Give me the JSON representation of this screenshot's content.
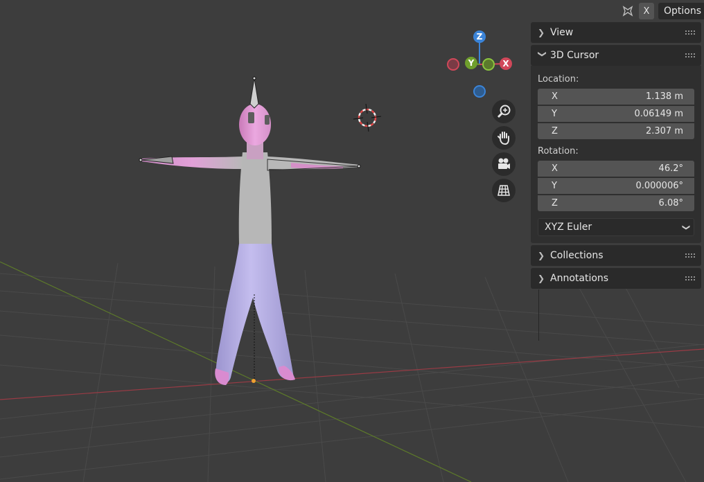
{
  "header": {
    "xray_label": "X",
    "options_label": "Options"
  },
  "nav_gizmo": {
    "z_label": "Z",
    "y_label": "Y",
    "x_label": "X"
  },
  "sidebar": {
    "view_label": "View",
    "cursor_label": "3D Cursor",
    "location_label": "Location:",
    "location": [
      {
        "axis": "X",
        "value": "1.138 m"
      },
      {
        "axis": "Y",
        "value": "0.06149 m"
      },
      {
        "axis": "Z",
        "value": "2.307 m"
      }
    ],
    "rotation_label": "Rotation:",
    "rotation": [
      {
        "axis": "X",
        "value": "46.2°"
      },
      {
        "axis": "Y",
        "value": "0.000006°"
      },
      {
        "axis": "Z",
        "value": "6.08°"
      }
    ],
    "rotation_mode": "XYZ Euler",
    "collections_label": "Collections",
    "annotations_label": "Annotations"
  },
  "icons": [
    "zoom-icon",
    "hand-icon",
    "camera-icon",
    "grid-icon",
    "xray-icon"
  ],
  "colors": {
    "x_axis": "#d1485a",
    "y_axis": "#6f9f2c",
    "z_axis": "#3b84d8",
    "mesh_top": "#e08fcf",
    "mesh_bottom": "#b0a8e0",
    "body_gray": "#b5b5b5"
  }
}
